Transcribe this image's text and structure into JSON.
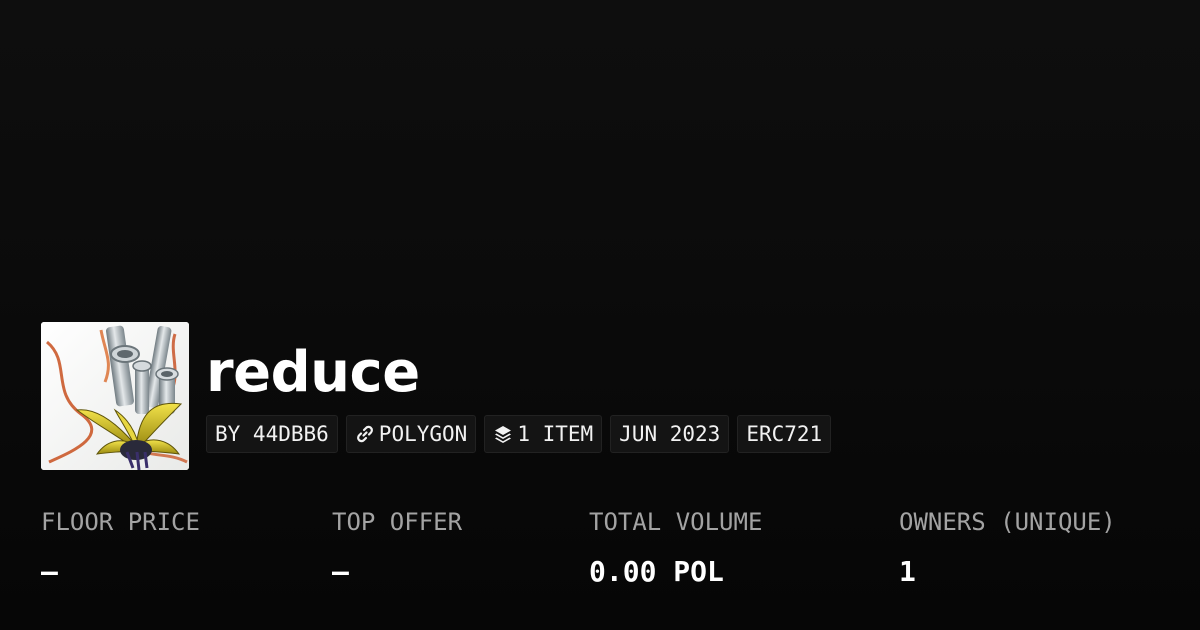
{
  "collection": {
    "name": "reduce",
    "avatar_icon": "abstract-3d-artwork-thumbnail"
  },
  "pills": {
    "creator": "BY 44DBB6",
    "chain": "POLYGON",
    "chain_icon": "link-icon",
    "items": "1 ITEM",
    "items_icon": "layers-icon",
    "date": "JUN 2023",
    "standard": "ERC721"
  },
  "stats": {
    "floor_price": {
      "label": "FLOOR PRICE",
      "value": "–"
    },
    "top_offer": {
      "label": "TOP OFFER",
      "value": "–"
    },
    "total_volume": {
      "label": "TOTAL VOLUME",
      "value": "0.00 POL"
    },
    "owners": {
      "label": "OWNERS (UNIQUE)",
      "value": "1"
    }
  },
  "colors": {
    "background": "#0b0b0b",
    "pill_background": "#141414",
    "label": "#a3a3a3",
    "text": "#ffffff"
  }
}
